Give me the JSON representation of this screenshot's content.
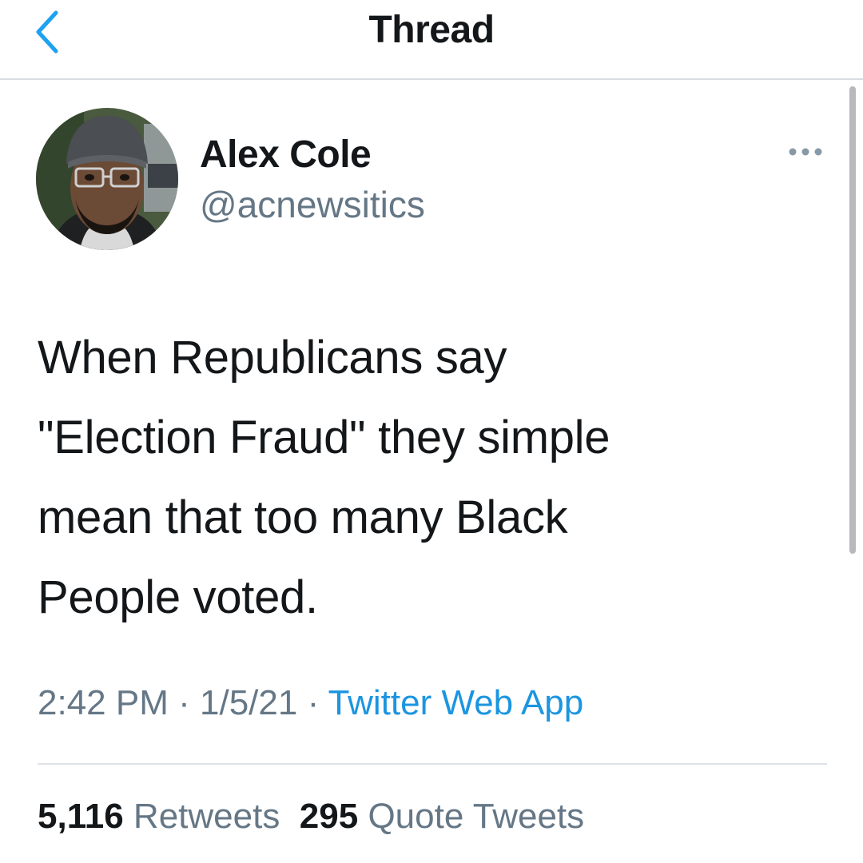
{
  "header": {
    "title": "Thread",
    "back_icon": "chevron-left-icon",
    "accent": "#1da1f2"
  },
  "tweet": {
    "author_name": "Alex Cole",
    "author_handle": "@acnewsitics",
    "more_icon": "more-horizontal-icon",
    "lines": [
      "When Republicans say",
      "\"Election Fraud\" they simple",
      "mean that too many Black",
      "People voted."
    ],
    "time": "2:42 PM",
    "date": "1/5/21",
    "separator": "·",
    "source": "Twitter Web App",
    "source_color": "#1b95e0"
  },
  "stats": {
    "retweets_count": "5,116",
    "retweets_label": "Retweets",
    "quotes_count": "295",
    "quotes_label": "Quote Tweets"
  }
}
